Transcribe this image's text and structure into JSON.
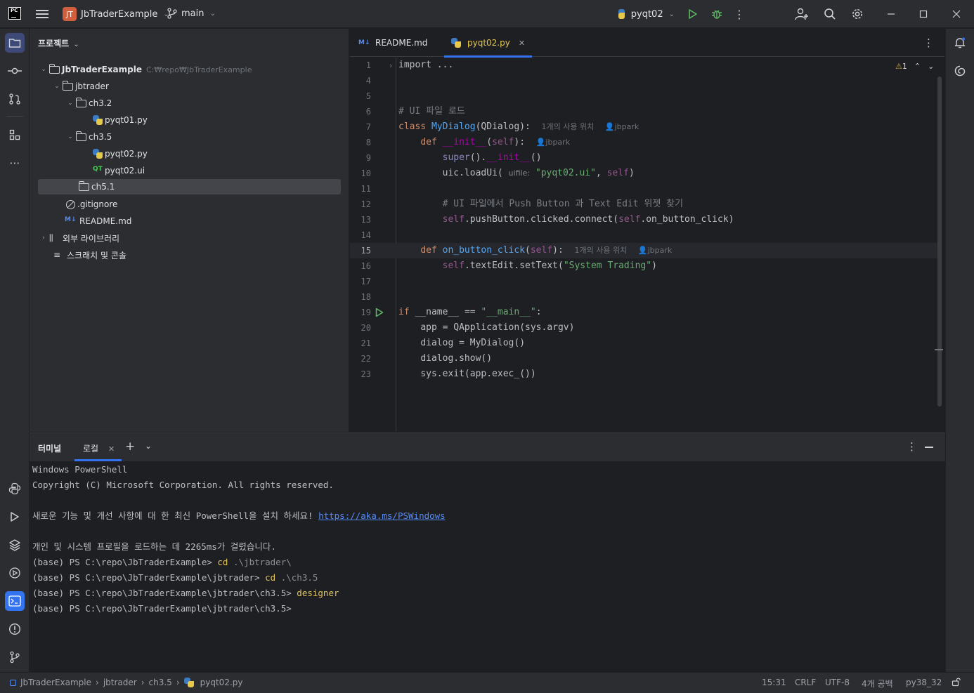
{
  "titlebar": {
    "logo_text": "PC",
    "project_badge": "JT",
    "project_name": "JbTraderExample",
    "branch": "main",
    "run_config": "pyqt02"
  },
  "project_panel": {
    "header": "프로젝트",
    "tree": [
      {
        "label": "JbTraderExample",
        "hint": "C:₩repo₩JbTraderExample",
        "type": "folder",
        "expanded": true
      },
      {
        "label": "jbtrader",
        "type": "folder",
        "expanded": true
      },
      {
        "label": "ch3.2",
        "type": "folder",
        "expanded": true
      },
      {
        "label": "pyqt01.py",
        "type": "python"
      },
      {
        "label": "ch3.5",
        "type": "folder",
        "expanded": true
      },
      {
        "label": "pyqt02.py",
        "type": "python"
      },
      {
        "label": "pyqt02.ui",
        "type": "qt",
        "icon_text": "QT"
      },
      {
        "label": "ch5.1",
        "type": "folder",
        "selected": true
      },
      {
        "label": ".gitignore",
        "type": "ignore"
      },
      {
        "label": "README.md",
        "type": "markdown",
        "icon_text": "M↓"
      },
      {
        "label": "외부 라이브러리",
        "type": "library"
      },
      {
        "label": "스크래치 및 콘솔",
        "type": "scratch"
      }
    ]
  },
  "editor": {
    "tabs": [
      {
        "label": "README.md",
        "icon_text": "M↓",
        "active": false
      },
      {
        "label": "pyqt02.py",
        "active": true
      }
    ],
    "warning_count": "1",
    "line_numbers": [
      "1",
      "4",
      "5",
      "6",
      "7",
      "8",
      "9",
      "10",
      "11",
      "12",
      "13",
      "14",
      "15",
      "16",
      "17",
      "18",
      "19",
      "20",
      "21",
      "22",
      "23"
    ],
    "current_line": "15",
    "code": {
      "l1": "import ...",
      "l6": "# UI 파일 로드",
      "l7_kw": "class",
      "l7_name": "MyDialog",
      "l7_rest": "(QDialog):",
      "l7_usage": "1개의 사용 위치",
      "l7_author": "jbpark",
      "l8_kw": "def",
      "l8_name": "__init__",
      "l8_self": "self",
      "l8_author": "jbpark",
      "l9_super": "super",
      "l9_rest": "().",
      "l9_init": "__init__",
      "l9_end": "()",
      "l10_a": "uic.loadUi(",
      "l10_hint": "uifile:",
      "l10_str": "\"pyqt02.ui\"",
      "l10_self": "self",
      "l12": "# UI 파일에서 Push Button 과 Text Edit 위젯 찾기",
      "l13_self1": "self",
      "l13_mid": ".pushButton.clicked.connect(",
      "l13_self2": "self",
      "l13_end": ".on_button_click)",
      "l15_kw": "def",
      "l15_name": "on_button_click",
      "l15_self": "self",
      "l15_usage": "1개의 사용 위치",
      "l15_author": "jbpark",
      "l16_self": "self",
      "l16_mid": ".textEdit.setText(",
      "l16_str": "\"System Trading\"",
      "l19_if": "if",
      "l19_name": "__name__",
      "l19_eq": "==",
      "l19_str": "\"__main__\"",
      "l20": "app = QApplication(sys.argv)",
      "l21": "dialog = MyDialog()",
      "l22": "dialog.show()",
      "l23": "sys.exit(app.exec_())"
    }
  },
  "terminal": {
    "title": "터미널",
    "tab": "로컬",
    "lines": {
      "t1": "Windows PowerShell",
      "t2": "Copyright (C) Microsoft Corporation. All rights reserved.",
      "t4": "새로운 기능 및 개선 사항에 대 한 최신 PowerShell을 설치 하세요!",
      "t4_link": "https://aka.ms/PSWindows",
      "t6": "개인 및 시스템 프로필을 로드하는 데 2265ms가 걸렸습니다.",
      "t7_prompt": "(base) PS C:\\repo\\JbTraderExample>",
      "t7_cmd": "cd",
      "t7_arg": ".\\jbtrader\\",
      "t8_prompt": "(base) PS C:\\repo\\JbTraderExample\\jbtrader>",
      "t8_cmd": "cd",
      "t8_arg": ".\\ch3.5",
      "t9_prompt": "(base) PS C:\\repo\\JbTraderExample\\jbtrader\\ch3.5>",
      "t9_cmd": "designer",
      "t10_prompt": "(base) PS C:\\repo\\JbTraderExample\\jbtrader\\ch3.5>"
    }
  },
  "statusbar": {
    "breadcrumb": [
      "JbTraderExample",
      "jbtrader",
      "ch3.5",
      "pyqt02.py"
    ],
    "position": "15:31",
    "line_sep": "CRLF",
    "encoding": "UTF-8",
    "indent": "4개 공백",
    "interpreter": "py38_32"
  },
  "colors": {
    "accent": "#3574f0",
    "panel_bg": "#2b2d30",
    "editor_bg": "#1e1f22",
    "project_badge": "#d0603d"
  }
}
